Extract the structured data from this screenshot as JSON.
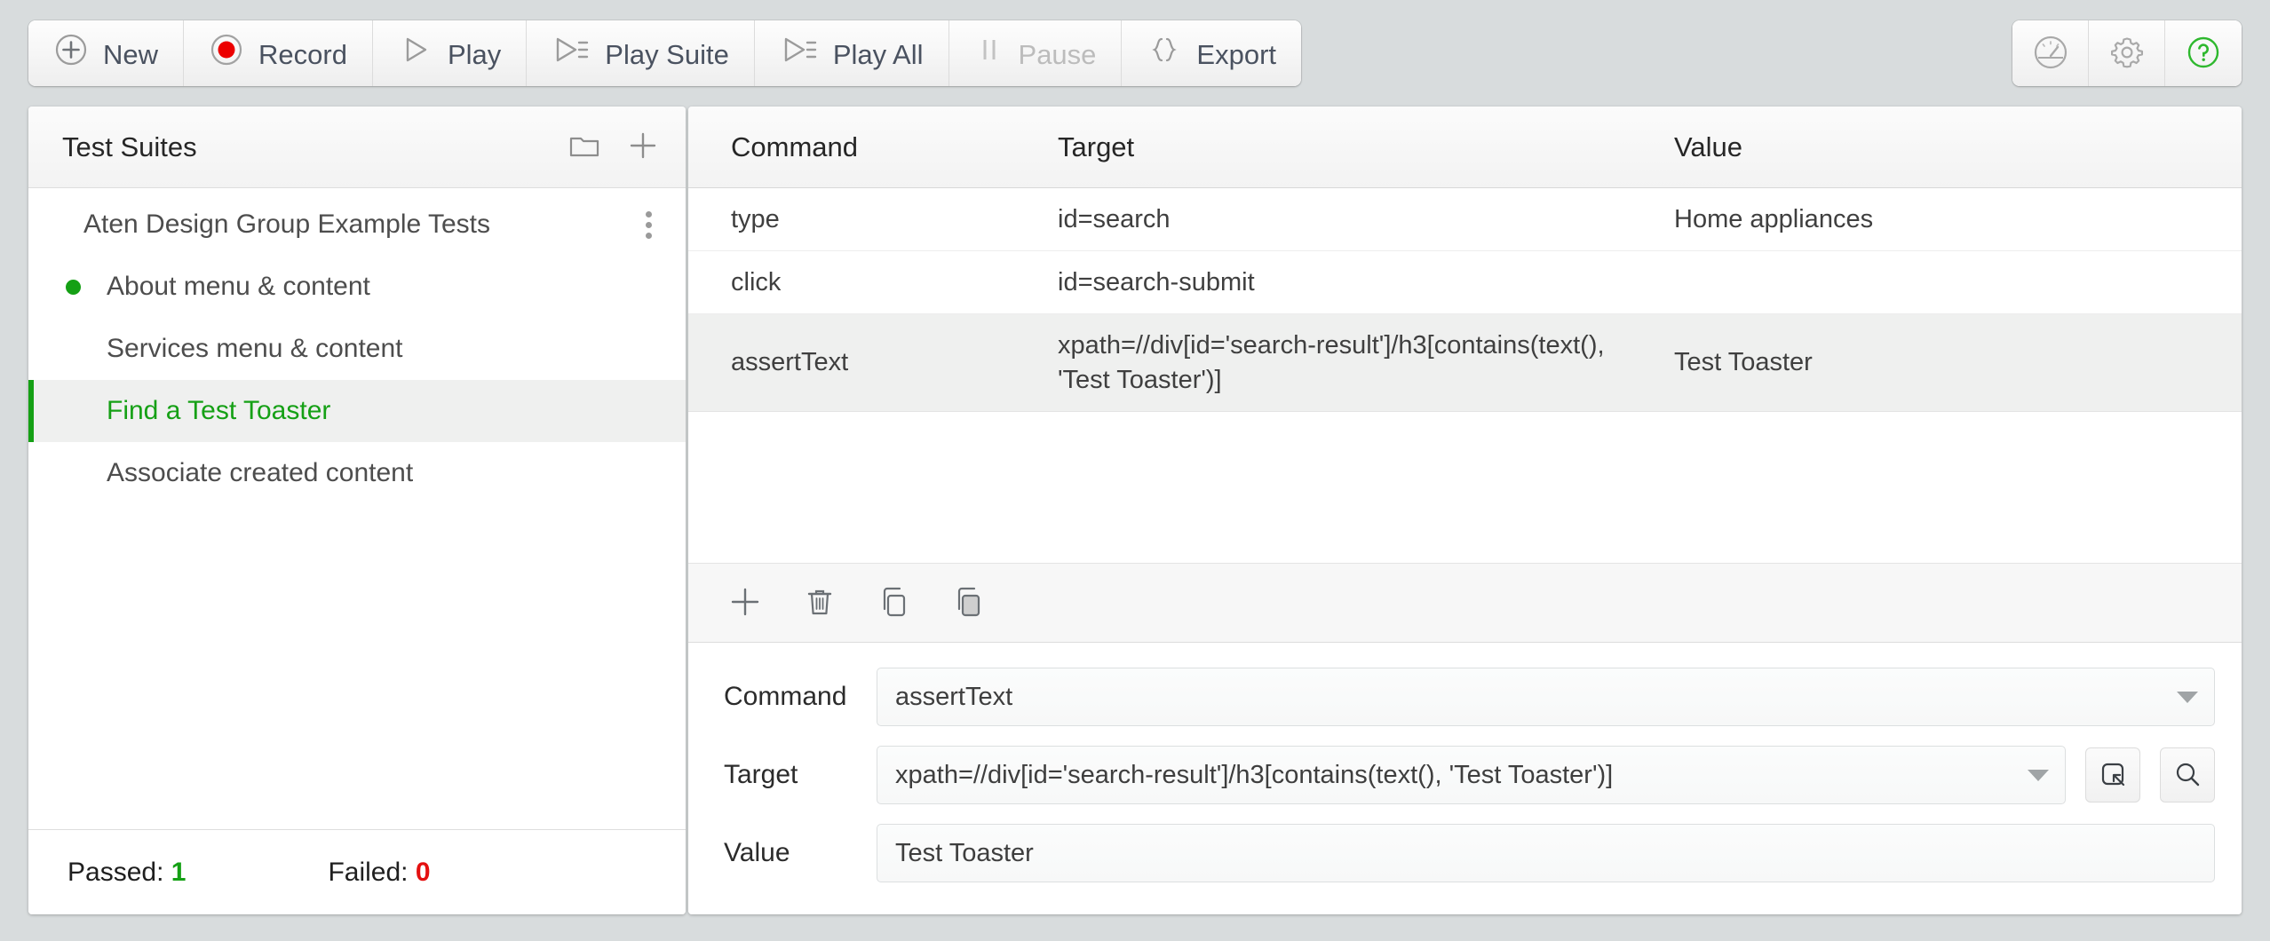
{
  "toolbar": {
    "buttons": [
      {
        "label": "New",
        "icon": "plus-circle-icon",
        "disabled": false
      },
      {
        "label": "Record",
        "icon": "record-circle-icon",
        "disabled": false
      },
      {
        "label": "Play",
        "icon": "play-icon",
        "disabled": false
      },
      {
        "label": "Play Suite",
        "icon": "play-list-icon",
        "disabled": false
      },
      {
        "label": "Play All",
        "icon": "play-list-icon",
        "disabled": false
      },
      {
        "label": "Pause",
        "icon": "pause-icon",
        "disabled": true
      },
      {
        "label": "Export",
        "icon": "braces-icon",
        "disabled": false
      }
    ],
    "right_icons": [
      {
        "name": "speedometer-icon"
      },
      {
        "name": "gear-icon"
      },
      {
        "name": "help-circle-icon"
      }
    ]
  },
  "sidebar": {
    "title": "Test Suites",
    "header_icons": [
      {
        "name": "folder-icon"
      },
      {
        "name": "plus-icon"
      }
    ],
    "suite": {
      "name": "Aten Design Group Example Tests",
      "menu_icon": "kebab-menu-icon"
    },
    "tests": [
      {
        "label": "About menu & content",
        "status": "passed",
        "selected": false
      },
      {
        "label": "Services menu & content",
        "status": "none",
        "selected": false
      },
      {
        "label": "Find a Test Toaster",
        "status": "none",
        "selected": true
      },
      {
        "label": "Associate created content",
        "status": "none",
        "selected": false
      }
    ],
    "footer": {
      "passed_label": "Passed:",
      "passed_count": "1",
      "failed_label": "Failed:",
      "failed_count": "0",
      "passed_color": "#15a015",
      "failed_color": "#e41010"
    }
  },
  "commands": {
    "headers": {
      "command": "Command",
      "target": "Target",
      "value": "Value"
    },
    "rows": [
      {
        "command": "type",
        "target": "id=search",
        "value": "Home appliances",
        "highlight": false
      },
      {
        "command": "click",
        "target": "id=search-submit",
        "value": "",
        "highlight": false
      },
      {
        "command": "assertText",
        "target": "xpath=//div[id='search-result']/h3[contains(text(), 'Test Toaster')]",
        "value": "Test Toaster",
        "highlight": true
      }
    ],
    "actions": [
      {
        "name": "add-command-icon"
      },
      {
        "name": "delete-command-icon"
      },
      {
        "name": "copy-command-icon"
      },
      {
        "name": "paste-command-icon"
      }
    ]
  },
  "form": {
    "command": {
      "label": "Command",
      "value": "assertText"
    },
    "target": {
      "label": "Target",
      "value": "xpath=//div[id='search-result']/h3[contains(text(), 'Test Toaster')]"
    },
    "value": {
      "label": "Value",
      "value": "Test Toaster"
    },
    "target_buttons": [
      {
        "name": "select-target-icon"
      },
      {
        "name": "find-target-icon"
      }
    ]
  },
  "colors": {
    "accent_green": "#15a015",
    "record_red": "#e41010",
    "chrome_bg": "#d8dcdd",
    "panel_bg": "#ffffff"
  }
}
